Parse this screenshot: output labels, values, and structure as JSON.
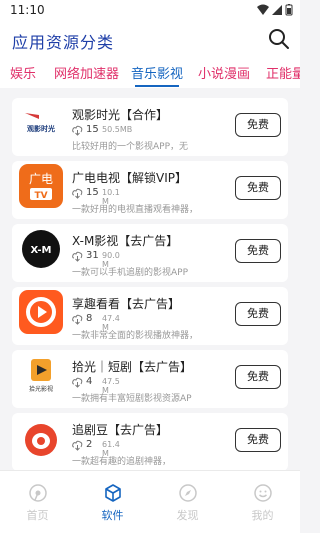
{
  "status_bar": {
    "time": "11:10"
  },
  "header": {
    "title": "应用资源分类"
  },
  "tabs": [
    {
      "label": "娱乐"
    },
    {
      "label": "网络加速器"
    },
    {
      "label": "音乐影视"
    },
    {
      "label": "小说漫画"
    },
    {
      "label": "正能量"
    }
  ],
  "apps": [
    {
      "name": "观影时光【合作】",
      "downloads": "15",
      "size": "50.5MB",
      "description": "比较好用的一个影视APP，无",
      "icon": "guanying-shiguang-logo",
      "icon_text": "观影时光",
      "action": "免费"
    },
    {
      "name": "广电电视【解锁VIP】",
      "downloads": "15",
      "size": "10.1 M",
      "description": "一款好用的电视直播观看神器，",
      "icon": "guangdian-tv-logo",
      "icon_text": "广电",
      "icon_subtext": "TV",
      "action": "免费"
    },
    {
      "name": "X-M影视【去广告】",
      "downloads": "31",
      "size": "90.0 M",
      "description": "一款可以手机追剧的影视APP",
      "icon": "xm-logo",
      "icon_text": "X-M",
      "action": "免费"
    },
    {
      "name": "享趣看看【去广告】",
      "downloads": "8",
      "size": "47.4 M",
      "description": "一款非常全面的影视播放神器，",
      "icon": "play-logo",
      "action": "免费"
    },
    {
      "name": "拾光｜短剧【去广告】",
      "downloads": "4",
      "size": "47.5 M",
      "description": "一款拥有丰富短剧影视资源AP",
      "icon": "shiguang-logo",
      "icon_text": "拾光影视",
      "action": "免费"
    },
    {
      "name": "追剧豆【去广告】",
      "downloads": "2",
      "size": "61.4 M",
      "description": "一款超有趣的追剧神器，",
      "icon": "zhuijudou-logo",
      "action": "免费"
    }
  ],
  "bottom_nav": [
    {
      "label": "首页",
      "icon": "home-icon",
      "active": false
    },
    {
      "label": "软件",
      "icon": "cube-icon",
      "active": true
    },
    {
      "label": "发现",
      "icon": "compass-icon",
      "active": false
    },
    {
      "label": "我的",
      "icon": "smile-icon",
      "active": false
    }
  ],
  "colors": {
    "accent_blue": "#1565c0",
    "tab_pink": "#e0306a",
    "title_blue": "#1f3fa8",
    "background": "#f4f4f6"
  }
}
